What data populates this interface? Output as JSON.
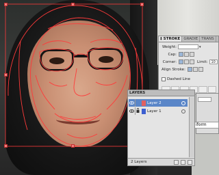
{
  "stroke_panel": {
    "tabs": [
      {
        "label": "‡ STROKE",
        "active": true
      },
      {
        "label": "GRADIE",
        "active": false
      },
      {
        "label": "TRANS",
        "active": false
      }
    ],
    "weight_label": "Weight:",
    "cap_label": "Cap:",
    "corner_label": "Corner:",
    "limit_label": "Limit:",
    "limit_value": "10",
    "align_label": "Align Stroke:",
    "dashed_label": "Dashed Line"
  },
  "side": {
    "uniform_label": "iform"
  },
  "layers_panel": {
    "title": "LAYERS",
    "layers": [
      {
        "name": "Layer 2",
        "color": "#e06060",
        "selected": true
      },
      {
        "name": "Layer 1",
        "color": "#3d5fd0",
        "selected": false
      }
    ],
    "footer_count": "2 Layers"
  },
  "colors": {
    "selection_blue": "#5a86c8",
    "path_red": "#ff3a3a",
    "panel_bg": "#e4e4e4"
  },
  "icons": [
    "eye-icon",
    "lock-icon",
    "target-circle-icon",
    "dropdown-arrow-icon"
  ]
}
